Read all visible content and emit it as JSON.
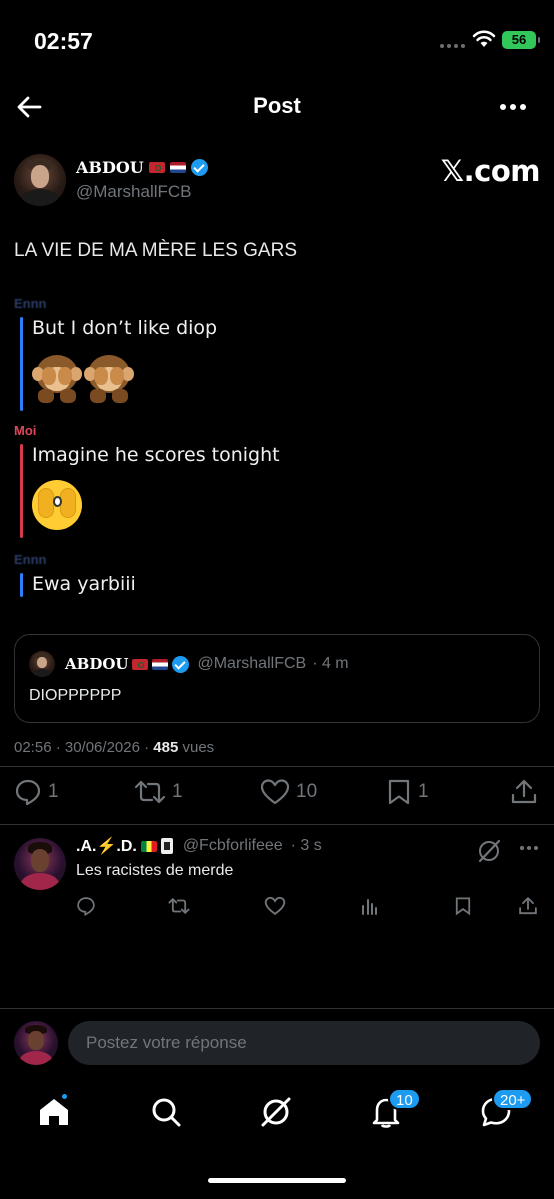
{
  "status_bar": {
    "time": "02:57",
    "battery": "56"
  },
  "header": {
    "title": "Post"
  },
  "author": {
    "name": "ABDOU",
    "handle": "@MarshallFCB",
    "brand": "𝕏.com"
  },
  "tweet": {
    "text": "LA VIE DE MA MÈRE LES GARS",
    "chat": [
      {
        "sender": "Ennn",
        "color": "blue",
        "message": "But I don’t like diop",
        "emoji": "see-no-evil-monkey-x2"
      },
      {
        "sender": "Moi",
        "color": "red",
        "message": "Imagine he scores tonight",
        "emoji": "face-with-peeking-eye"
      },
      {
        "sender": "Ennn",
        "color": "blue",
        "message": "Ewa yarbiii",
        "emoji": ""
      }
    ]
  },
  "quote": {
    "name": "ABDOU",
    "handle": "@MarshallFCB",
    "time": "· 4 m",
    "text": "DIOPPPPPP"
  },
  "meta": {
    "time": "02:56 · 30/06/2026 · ",
    "views": "485",
    "views_label": " vues"
  },
  "actions": {
    "replies": "1",
    "reposts": "1",
    "likes": "10",
    "bookmarks": "1"
  },
  "reply": {
    "name": ".A.⚡️.D.",
    "handle": "@Fcbforlifeee",
    "time": "· 3 s",
    "text": "Les racistes de merde"
  },
  "compose": {
    "placeholder": "Postez votre réponse"
  },
  "tabbar": {
    "notifications_badge": "10",
    "messages_badge": "20+"
  },
  "colors": {
    "accent": "#1d9bf0",
    "background": "#000000",
    "muted": "#71767b",
    "battery": "#32c759"
  }
}
